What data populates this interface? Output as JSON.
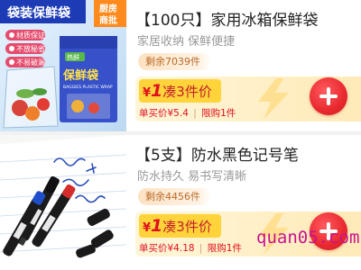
{
  "products": [
    {
      "thumb_banner": "袋装保鲜袋",
      "thumb_corner": "厨房\n商批",
      "thumb_tags": [
        "材质保证",
        "不放秘省",
        "不易破漏"
      ],
      "thumb_pack_brand": "保鲜袋",
      "thumb_pack_small": "BAGGIES PLASTIC WRAP",
      "title": "【100只】家用冰箱保鲜袋",
      "subtitle": "家居收纳 保鲜便捷",
      "stock": "剩余7039件",
      "promo_yen": "¥",
      "promo_count": "1",
      "promo_text": "凑3件价",
      "unit_price": "单买价¥5.4",
      "limit": "限购1件"
    },
    {
      "title": "【5支】防水黑色记号笔",
      "subtitle": "防水持久 易书写清晰",
      "stock": "剩余4456件",
      "promo_yen": "¥",
      "promo_count": "1",
      "promo_text": "凑3件价",
      "unit_price": "单买价¥4.18",
      "limit": "限购1件"
    }
  ],
  "watermark": "quan05.com",
  "colors": {
    "accent_red": "#e0101e",
    "promo_yellow": "#ffd33a",
    "stock_text": "#b86a2a"
  }
}
